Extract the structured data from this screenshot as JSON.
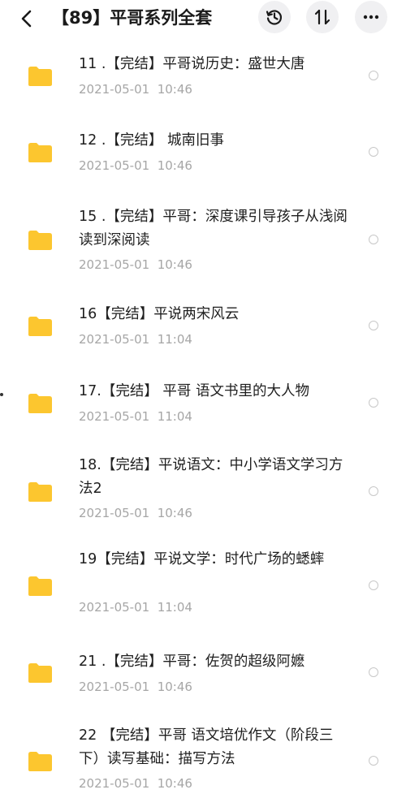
{
  "header": {
    "title": "【89】平哥系列全套",
    "back_icon": "chevron-left-icon",
    "history_icon": "history-icon",
    "sort_icon": "sort-icon",
    "more_icon": "more-icon"
  },
  "colors": {
    "folder": "#fcc62f",
    "date_text": "#a6a6a6",
    "button_bg": "#f0f0f2"
  },
  "files": [
    {
      "name": "11 .【完结】平哥说历史：盛世大唐",
      "date": "2021-05-01  10:46"
    },
    {
      "name": "12 .【完结】 城南旧事",
      "date": "2021-05-01  10:46"
    },
    {
      "name": "15 .【完结】平哥：深度课引导孩子从浅阅读到深阅读",
      "date": "2021-05-01  10:46"
    },
    {
      "name": "16【完结】平说两宋风云",
      "date": "2021-05-01  11:04"
    },
    {
      "name": "17.【完结】 平哥 语文书里的大人物",
      "date": "2021-05-01  11:04"
    },
    {
      "name": "18.【完结】平说语文：中小学语文学习方法2",
      "date": "2021-05-01  10:46"
    },
    {
      "name": "19【完结】平说文学：时代广场的蟋蟀",
      "date": "2021-05-01  11:04"
    },
    {
      "name": "21 .【完结】平哥：佐贺的超级阿嬷",
      "date": "2021-05-01  10:46"
    },
    {
      "name": "22 【完结】平哥 语文培优作文（阶段三下）读写基础：描写方法",
      "date": "2021-05-01  10:46"
    }
  ]
}
